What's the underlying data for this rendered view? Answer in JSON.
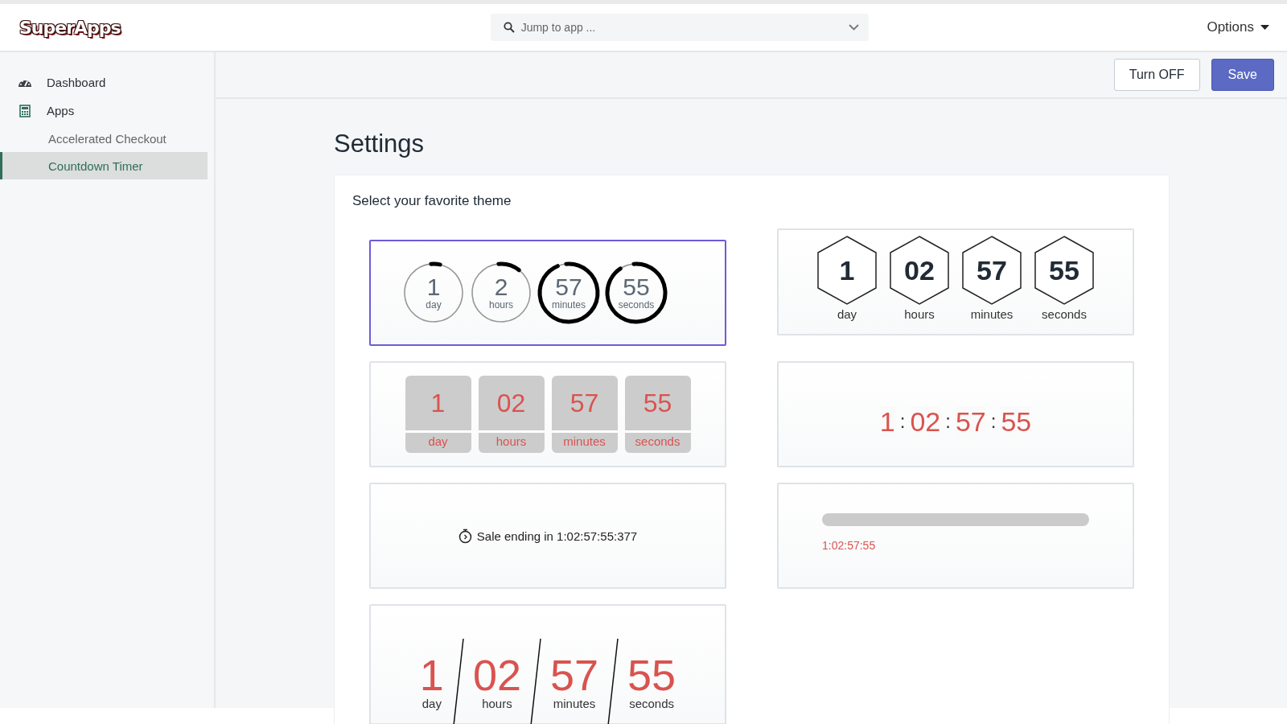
{
  "header": {
    "logo": "SuperApps",
    "search": {
      "placeholder": "Jump to app ..."
    },
    "options": "Options"
  },
  "sidebar": {
    "items": [
      {
        "label": "Dashboard"
      },
      {
        "label": "Apps",
        "children": [
          {
            "label": "Accelerated Checkout",
            "selected": false
          },
          {
            "label": "Countdown Timer",
            "selected": true
          }
        ]
      }
    ]
  },
  "toolbar": {
    "buttons": [
      {
        "label": "Turn OFF",
        "kind": "secondary"
      },
      {
        "label": "Save",
        "kind": "primary"
      }
    ]
  },
  "page_title": "Settings",
  "card_title": "Select your favorite theme",
  "themes": [
    {
      "kind": "circles",
      "selected": true,
      "units": [
        {
          "value": "1",
          "label": "day",
          "level": 0.05
        },
        {
          "value": "2",
          "label": "hours",
          "level": 0.12
        },
        {
          "value": "57",
          "label": "minutes",
          "level": 0.95
        },
        {
          "value": "55",
          "label": "seconds",
          "level": 0.92
        }
      ]
    },
    {
      "kind": "hexagons",
      "selected": false,
      "units": [
        {
          "value": "1",
          "label": "day"
        },
        {
          "value": "02",
          "label": "hours"
        },
        {
          "value": "57",
          "label": "minutes"
        },
        {
          "value": "55",
          "label": "seconds"
        }
      ]
    },
    {
      "kind": "blocks",
      "selected": false,
      "units": [
        {
          "value": "1",
          "label": "day"
        },
        {
          "value": "02",
          "label": "hours"
        },
        {
          "value": "57",
          "label": "minutes"
        },
        {
          "value": "55",
          "label": "seconds"
        }
      ]
    },
    {
      "kind": "colon",
      "selected": false,
      "units": [
        {
          "value": "1"
        },
        {
          "value": "02"
        },
        {
          "value": "57"
        },
        {
          "value": "55"
        }
      ],
      "separators": [
        ":",
        ":",
        ":"
      ]
    },
    {
      "kind": "text",
      "selected": false,
      "text": "Sale ending in 1:02:57:55:377"
    },
    {
      "kind": "progress",
      "selected": false,
      "text": "1:02:57:55"
    },
    {
      "kind": "slanted",
      "selected": false,
      "units": [
        {
          "value": "1",
          "label": "day"
        },
        {
          "value": "02",
          "label": "hours"
        },
        {
          "value": "57",
          "label": "minutes"
        },
        {
          "value": "55",
          "label": "seconds"
        }
      ]
    }
  ]
}
